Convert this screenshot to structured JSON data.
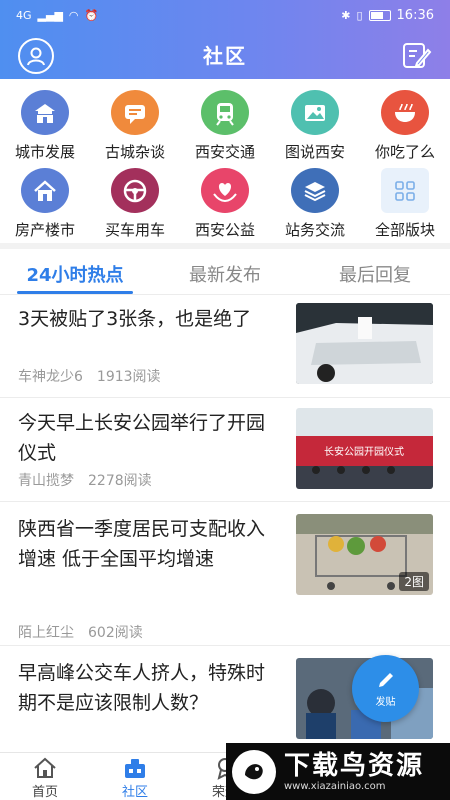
{
  "status": {
    "network": "4G",
    "time": "16:36"
  },
  "header": {
    "title": "社区"
  },
  "categories": [
    {
      "label": "城市发展",
      "icon": "city-gate-icon",
      "color": "#5b7fd6"
    },
    {
      "label": "古城杂谈",
      "icon": "chat-bubble-icon",
      "color": "#f08a3c"
    },
    {
      "label": "西安交通",
      "icon": "train-icon",
      "color": "#5cbf6a"
    },
    {
      "label": "图说西安",
      "icon": "picture-icon",
      "color": "#4fc0b0"
    },
    {
      "label": "你吃了么",
      "icon": "bowl-icon",
      "color": "#e8543f"
    },
    {
      "label": "房产楼市",
      "icon": "house-icon",
      "color": "#5b7fd6"
    },
    {
      "label": "买车用车",
      "icon": "steering-wheel-icon",
      "color": "#a3305c"
    },
    {
      "label": "西安公益",
      "icon": "heart-hands-icon",
      "color": "#e8456a"
    },
    {
      "label": "站务交流",
      "icon": "layers-icon",
      "color": "#3f6fb8"
    },
    {
      "label": "全部版块",
      "icon": "grid-icon",
      "color": "#e8f1fb"
    }
  ],
  "tabs": [
    {
      "label": "24小时热点"
    },
    {
      "label": "最新发布"
    },
    {
      "label": "最后回复"
    }
  ],
  "posts": [
    {
      "title": "3天被贴了3张条，也是绝了",
      "author": "车神龙少6",
      "reads": "1913阅读"
    },
    {
      "title": "今天早上长安公园举行了开园仪式",
      "author": "青山揽梦",
      "reads": "2278阅读"
    },
    {
      "title": "陕西省一季度居民可支配收入增速 低于全国平均增速",
      "author": "陌上红尘",
      "reads": "602阅读",
      "image_count": "2图"
    },
    {
      "title": "早高峰公交车人挤人，特殊时期不是应该限制人数？"
    }
  ],
  "thumb_banner_text": "长安公园开园仪式",
  "fab": {
    "label": "发贴"
  },
  "bottom_nav": [
    {
      "label": "首页",
      "icon": "home-icon"
    },
    {
      "label": "社区",
      "icon": "community-icon"
    },
    {
      "label": "荣耀",
      "icon": "honor-icon"
    }
  ],
  "watermark": {
    "text": "下载鸟资源",
    "url": "www.xiazainiao.com"
  }
}
